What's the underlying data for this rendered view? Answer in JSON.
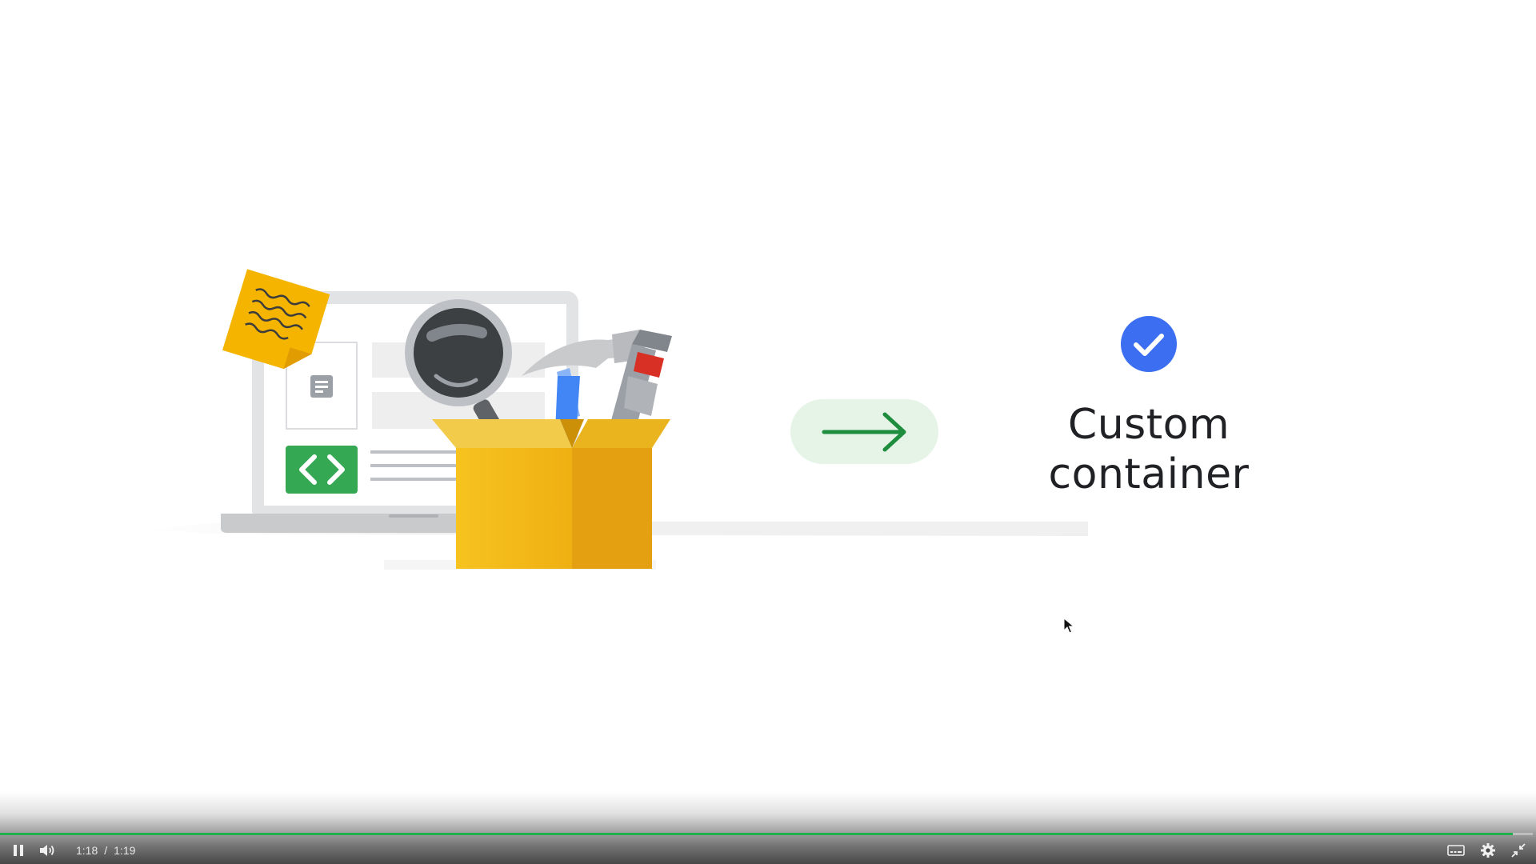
{
  "slide": {
    "headline_line1": "Custom",
    "headline_line2": "container"
  },
  "icons": {
    "check_badge": "check-circle-icon",
    "arrow": "arrow-right-icon",
    "code": "code-brackets-icon",
    "note": "sticky-note-icon",
    "magnifier": "magnifying-glass-icon",
    "hammer": "hammer-icon",
    "box": "open-box-icon"
  },
  "colors": {
    "check_blue": "#3b6ef0",
    "arrow_green": "#1e8e3e",
    "arrow_pill_bg": "#e6f4e8",
    "code_green": "#34a853",
    "box_yellow": "#f4b400",
    "progress": "#20b04b"
  },
  "player": {
    "current_time": "1:18",
    "separator": "/",
    "duration": "1:19",
    "progress_fraction": 0.987,
    "state": "playing"
  }
}
